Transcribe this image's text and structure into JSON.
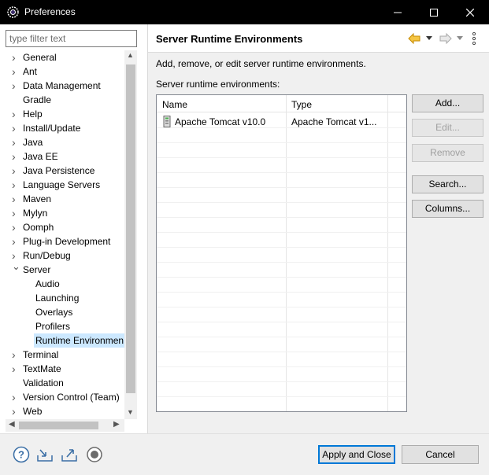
{
  "window": {
    "title": "Preferences"
  },
  "filter": {
    "placeholder": "type filter text"
  },
  "tree": [
    {
      "label": "General",
      "expandable": true
    },
    {
      "label": "Ant",
      "expandable": true
    },
    {
      "label": "Data Management",
      "expandable": true
    },
    {
      "label": "Gradle",
      "expandable": false
    },
    {
      "label": "Help",
      "expandable": true
    },
    {
      "label": "Install/Update",
      "expandable": true
    },
    {
      "label": "Java",
      "expandable": true
    },
    {
      "label": "Java EE",
      "expandable": true
    },
    {
      "label": "Java Persistence",
      "expandable": true
    },
    {
      "label": "Language Servers",
      "expandable": true
    },
    {
      "label": "Maven",
      "expandable": true
    },
    {
      "label": "Mylyn",
      "expandable": true
    },
    {
      "label": "Oomph",
      "expandable": true
    },
    {
      "label": "Plug-in Development",
      "expandable": true
    },
    {
      "label": "Run/Debug",
      "expandable": true
    },
    {
      "label": "Server",
      "expanded": true
    },
    {
      "label": "Audio",
      "child": true
    },
    {
      "label": "Launching",
      "child": true
    },
    {
      "label": "Overlays",
      "child": true
    },
    {
      "label": "Profilers",
      "child": true
    },
    {
      "label": "Runtime Environmen",
      "child": true,
      "selected": true
    },
    {
      "label": "Terminal",
      "expandable": true
    },
    {
      "label": "TextMate",
      "expandable": true
    },
    {
      "label": "Validation",
      "expandable": false
    },
    {
      "label": "Version Control (Team)",
      "expandable": true
    },
    {
      "label": "Web",
      "expandable": true
    }
  ],
  "page": {
    "title": "Server Runtime Environments",
    "description": "Add, remove, or edit server runtime environments.",
    "table_label": "Server runtime environments:",
    "columns": [
      "Name",
      "Type"
    ],
    "rows": [
      {
        "name": "Apache Tomcat v10.0",
        "type": "Apache Tomcat v1..."
      }
    ]
  },
  "buttons": {
    "add": "Add...",
    "edit": "Edit...",
    "remove": "Remove",
    "search": "Search...",
    "columns": "Columns..."
  },
  "footer": {
    "apply_close": "Apply and Close",
    "cancel": "Cancel"
  },
  "colors": {
    "selection": "#cce8ff",
    "default_button_border": "#0078d7",
    "nav_back": "#e8a000"
  }
}
